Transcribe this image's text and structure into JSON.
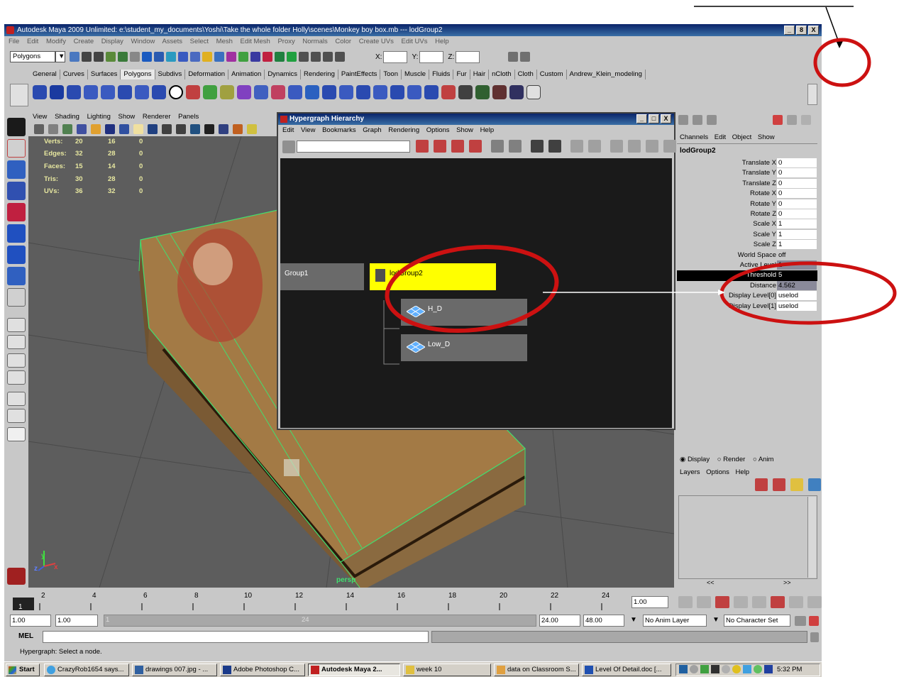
{
  "window": {
    "title": "Autodesk Maya 2009 Unlimited: e:\\student_my_documents\\Yoshi\\Take the whole folder Holly\\scenes\\Monkey boy box.mb   ---   lodGroup2",
    "min": "_",
    "max": "8",
    "close": "X"
  },
  "menubar": [
    "File",
    "Edit",
    "Modify",
    "Create",
    "Display",
    "Window",
    "Assets",
    "Select",
    "Mesh",
    "Edit Mesh",
    "Proxy",
    "Normals",
    "Color",
    "Create UVs",
    "Edit UVs",
    "Help"
  ],
  "statusline": {
    "mode": "Polygons",
    "x_label": "X:",
    "y_label": "Y:",
    "z_label": "Z:"
  },
  "shelf_tabs": [
    "General",
    "Curves",
    "Surfaces",
    "Polygons",
    "Subdivs",
    "Deformation",
    "Animation",
    "Dynamics",
    "Rendering",
    "PaintEffects",
    "Toon",
    "Muscle",
    "Fluids",
    "Fur",
    "Hair",
    "nCloth",
    "Cloth",
    "Custom",
    "Andrew_Klein_modeling"
  ],
  "viewport": {
    "menu": [
      "View",
      "Shading",
      "Lighting",
      "Show",
      "Renderer",
      "Panels"
    ],
    "hud": [
      {
        "label": "Verts:",
        "a": "20",
        "b": "16",
        "c": "0"
      },
      {
        "label": "Edges:",
        "a": "32",
        "b": "28",
        "c": "0"
      },
      {
        "label": "Faces:",
        "a": "15",
        "b": "14",
        "c": "0"
      },
      {
        "label": "Tris:",
        "a": "30",
        "b": "28",
        "c": "0"
      },
      {
        "label": "UVs:",
        "a": "36",
        "b": "32",
        "c": "0"
      }
    ],
    "camera": "persp",
    "axis_y": "y",
    "axis_x": "x",
    "axis_z": "z"
  },
  "hypergraph": {
    "title": "Hypergraph Hierarchy",
    "menu": [
      "Edit",
      "View",
      "Bookmarks",
      "Graph",
      "Rendering",
      "Options",
      "Show",
      "Help"
    ],
    "nodes": {
      "group1": "Group1",
      "lodgroup": "lodGroup2",
      "h": "H_D",
      "low": "Low_D"
    },
    "close": "X"
  },
  "channels": {
    "menu": [
      "Channels",
      "Edit",
      "Object",
      "Show"
    ],
    "object": "lodGroup2",
    "rows": [
      {
        "label": "Translate X",
        "value": "0"
      },
      {
        "label": "Translate Y",
        "value": "0"
      },
      {
        "label": "Translate Z",
        "value": "0"
      },
      {
        "label": "Rotate X",
        "value": "0"
      },
      {
        "label": "Rotate Y",
        "value": "0"
      },
      {
        "label": "Rotate Z",
        "value": "0"
      },
      {
        "label": "Scale X",
        "value": "1"
      },
      {
        "label": "Scale Y",
        "value": "1"
      },
      {
        "label": "Scale Z",
        "value": "1"
      },
      {
        "label": "World Space",
        "value": "off"
      },
      {
        "label": "Active Level",
        "value": "1"
      },
      {
        "label": "Threshold",
        "value": "5"
      },
      {
        "label": "Distance",
        "value": "4.562"
      },
      {
        "label": "Display Level[0]",
        "value": "uselod"
      },
      {
        "label": "Display Level[1]",
        "value": "uselod"
      }
    ]
  },
  "layers": {
    "radio": [
      "Display",
      "Render",
      "Anim"
    ],
    "menu": [
      "Layers",
      "Options",
      "Help"
    ],
    "prev": "<<",
    "next": ">>"
  },
  "timeline": {
    "ticks": [
      "2",
      "4",
      "6",
      "8",
      "10",
      "12",
      "14",
      "16",
      "18",
      "20",
      "22",
      "24"
    ],
    "current_frame": "1",
    "current_time": "1.00"
  },
  "range": {
    "start": "1.00",
    "start2": "1.00",
    "slider_start": "1",
    "slider_end": "24",
    "end": "24.00",
    "end2": "48.00",
    "anim_layer": "No Anim Layer",
    "char_set": "No Character Set"
  },
  "cmdline": {
    "label": "MEL"
  },
  "helpline": {
    "text": "Hypergraph: Select a node."
  },
  "taskbar": {
    "start": "Start",
    "items": [
      "CrazyRob1654 says...",
      "drawings 007.jpg - ...",
      "Adobe Photoshop C...",
      "Autodesk Maya 2...",
      "week 10",
      "data on Classroom S...",
      "Level Of Detail.doc [..."
    ],
    "clock": "5:32 PM"
  },
  "colors": {
    "annotation": "#cc1111",
    "lod_node": "#ffff00",
    "graph_bg": "#1a1a1a",
    "title_bar": "#0a246a"
  }
}
